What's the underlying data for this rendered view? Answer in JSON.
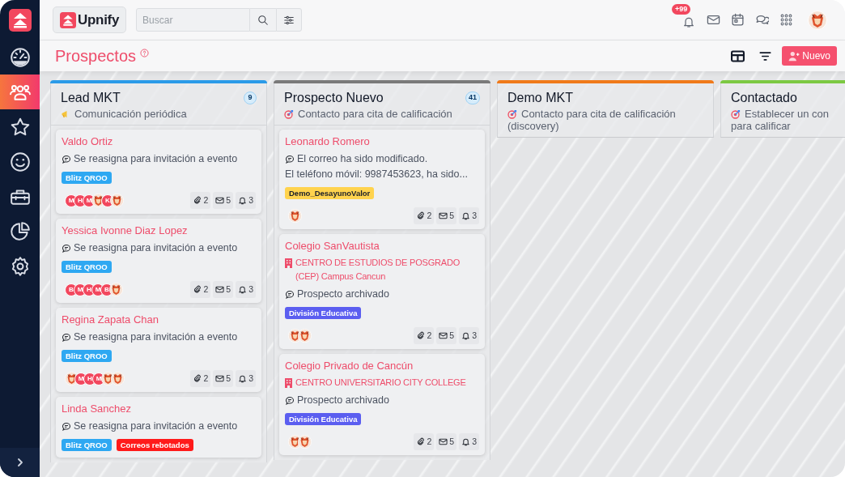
{
  "sidebar": {
    "items": [
      {
        "selected": false
      },
      {
        "selected": true
      },
      {
        "selected": false
      },
      {
        "selected": false
      },
      {
        "selected": false
      },
      {
        "selected": false
      },
      {
        "selected": false
      }
    ]
  },
  "topbar": {
    "logo": "Upnify",
    "search": {
      "placeholder": "Buscar"
    },
    "notification_badge": "+99"
  },
  "page": {
    "title": "Prospectos",
    "new_button": "Nuevo"
  },
  "columns": [
    {
      "title": "Lead MKT",
      "color": "#2b9be8",
      "count": "9",
      "subtitle_lines": [
        "Comunicación periódica"
      ],
      "cards": [
        {
          "name": "Valdo Ortiz",
          "notes": [
            "Se reasigna para invitación a evento"
          ],
          "tags": [
            {
              "label": "Blitz QROO",
              "color": "#2ea8f2"
            }
          ],
          "avatars": [
            {
              "kind": "initials",
              "text": "M"
            },
            {
              "kind": "initials",
              "text": "H"
            },
            {
              "kind": "initials",
              "text": "M"
            },
            {
              "kind": "photo"
            },
            {
              "kind": "initials",
              "text": "K"
            },
            {
              "kind": "photo"
            }
          ],
          "counts": [
            "2",
            "5",
            "3"
          ]
        },
        {
          "name": "Yessica Ivonne Diaz Lopez",
          "notes": [
            "Se reasigna para invitación a evento"
          ],
          "tags": [
            {
              "label": "Blitz QROO",
              "color": "#2ea8f2"
            }
          ],
          "avatars": [
            {
              "kind": "initials",
              "text": "B"
            },
            {
              "kind": "initials",
              "text": "M"
            },
            {
              "kind": "initials",
              "text": "H"
            },
            {
              "kind": "initials",
              "text": "M"
            },
            {
              "kind": "initials",
              "text": "B"
            },
            {
              "kind": "photo"
            }
          ],
          "counts": [
            "2",
            "5",
            "3"
          ]
        },
        {
          "name": "Regina Zapata Chan",
          "notes": [
            "Se reasigna para invitación a evento"
          ],
          "tags": [
            {
              "label": "Blitz QROO",
              "color": "#2ea8f2"
            }
          ],
          "avatars": [
            {
              "kind": "photo"
            },
            {
              "kind": "initials",
              "text": "M"
            },
            {
              "kind": "initials",
              "text": "H"
            },
            {
              "kind": "initials",
              "text": "M"
            },
            {
              "kind": "photo"
            },
            {
              "kind": "photo"
            }
          ],
          "counts": [
            "2",
            "5",
            "3"
          ]
        },
        {
          "name": "Linda Sanchez",
          "notes": [
            "Se reasigna para invitación a evento"
          ],
          "tags": [
            {
              "label": "Blitz QROO",
              "color": "#2ea8f2"
            },
            {
              "label": "Correos rebotados",
              "color": "#ff1a1a"
            }
          ]
        }
      ]
    },
    {
      "title": "Prospecto Nuevo",
      "color": "#7a7a7a",
      "count": "41",
      "subtitle_lines": [
        "Contacto para cita de calificación"
      ],
      "cards": [
        {
          "name": "Leonardo Romero",
          "notes": [
            "El correo ha sido modificado.",
            "El teléfono móvil: 9987453623, ha sido..."
          ],
          "tags": [
            {
              "label": "Demo_DesayunoValor",
              "color": "#ffd34e"
            }
          ],
          "avatars": [
            {
              "kind": "photo"
            }
          ],
          "counts": [
            "2",
            "5",
            "3"
          ]
        },
        {
          "name": "Colegio SanVautista",
          "company": "CENTRO DE ESTUDIOS DE POSGRADO (CEP) Campus Cancun",
          "notes": [
            "Prospecto archivado"
          ],
          "tags": [
            {
              "label": "División Educativa",
              "color": "#5b5ef0"
            }
          ],
          "avatars": [
            {
              "kind": "photo"
            },
            {
              "kind": "photo"
            }
          ],
          "counts": [
            "2",
            "5",
            "3"
          ]
        },
        {
          "name": "Colegio Privado de Cancún",
          "company": "CENTRO UNIVERSITARIO CITY COLLEGE",
          "notes": [
            "Prospecto archivado"
          ],
          "tags": [
            {
              "label": "División Educativa",
              "color": "#5b5ef0"
            }
          ],
          "avatars": [
            {
              "kind": "photo"
            },
            {
              "kind": "photo"
            }
          ],
          "counts": [
            "2",
            "5",
            "3"
          ]
        }
      ]
    },
    {
      "title": "Demo MKT",
      "color": "#f07a1a",
      "subtitle_lines": [
        "Contacto para cita de calificación",
        "(discovery)"
      ]
    },
    {
      "title": "Contactado",
      "color": "#7cc943",
      "subtitle_lines": [
        "Establecer un con",
        "para calificar"
      ]
    }
  ]
}
